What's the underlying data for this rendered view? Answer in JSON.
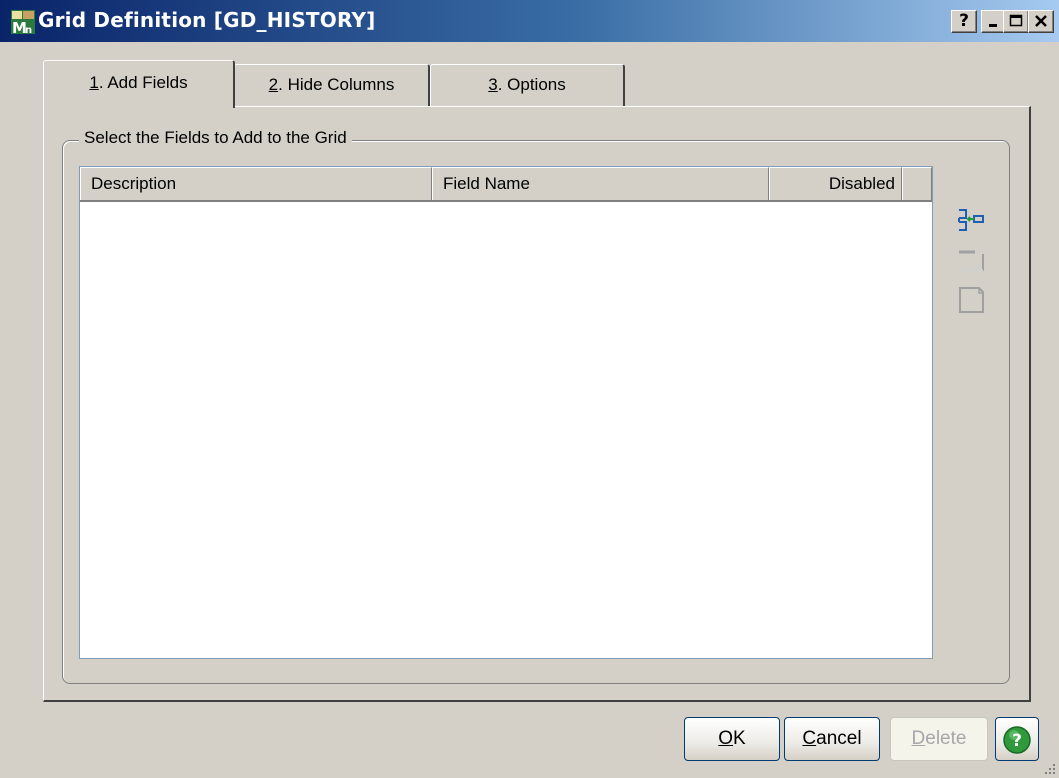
{
  "window": {
    "title": "Grid Definition  [GD_HISTORY]",
    "controls": {
      "help": "?",
      "minimize": "_",
      "maximize": "□",
      "close": "X"
    }
  },
  "tabs": [
    {
      "num": "1",
      "rest": ". Add Fields",
      "selected": true
    },
    {
      "num": "2",
      "rest": ". Hide Columns",
      "selected": false
    },
    {
      "num": "3",
      "rest": ". Options",
      "selected": false
    }
  ],
  "group": {
    "label": "Select the Fields to Add to the Grid"
  },
  "grid": {
    "columns": [
      "Description",
      "Field Name",
      "Disabled",
      ""
    ],
    "rows": []
  },
  "side_icons": [
    "insert-field-icon",
    "field-icon",
    "document-icon"
  ],
  "buttons": {
    "ok": {
      "accel": "O",
      "rest": "K"
    },
    "cancel": {
      "accel": "C",
      "rest": "ancel"
    },
    "delete": {
      "accel": "D",
      "rest": "elete",
      "disabled": true
    },
    "help_icon": "help-icon"
  },
  "colors": {
    "titlebar_start": "#0a246a",
    "titlebar_end": "#a6caf0",
    "face": "#d4d0c8",
    "help_green": "#2e9a3b"
  }
}
